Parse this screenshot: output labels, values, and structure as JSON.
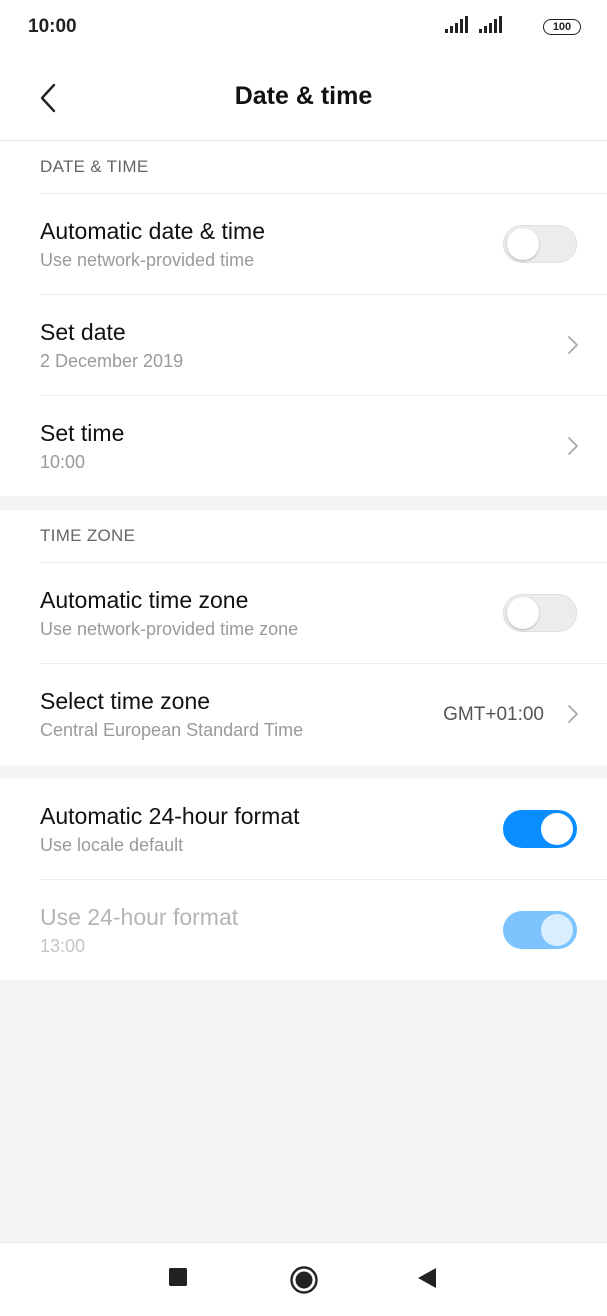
{
  "status_bar": {
    "time": "10:00",
    "battery": "100",
    "icons": [
      "signal-icon",
      "signal-icon",
      "battery-icon"
    ]
  },
  "app_bar": {
    "back_icon": "back-arrow-icon",
    "title": "Date & time"
  },
  "date_time_section": {
    "header": "DATE & TIME",
    "automatic": {
      "label": "Automatic date & time",
      "summary": "Use network-provided time",
      "toggle_on": false
    },
    "set_date": {
      "label": "Set date",
      "summary": "2 December 2019"
    },
    "set_time": {
      "label": "Set time",
      "summary": "10:00"
    }
  },
  "time_zone_section": {
    "header": "TIME ZONE",
    "automatic": {
      "label": "Automatic time zone",
      "summary": "Use network-provided time zone",
      "toggle_on": false
    },
    "select": {
      "label": "Select time zone",
      "summary": "Central European Standard Time",
      "value": "GMT+01:00"
    }
  },
  "format_section": {
    "automatic_24h": {
      "label": "Automatic 24-hour format",
      "summary": "Use locale default",
      "toggle_on": true
    },
    "use_24h": {
      "label": "Use 24-hour format",
      "summary": "13:00",
      "toggle_on": true,
      "disabled": true
    }
  },
  "nav_bar": {
    "buttons": [
      "recents-square-icon",
      "home-circle-icon",
      "back-triangle-icon"
    ]
  },
  "colors": {
    "accent": "#0a8dff",
    "accent_disabled": "#7dc4ff",
    "background": "#f5f5f5"
  }
}
